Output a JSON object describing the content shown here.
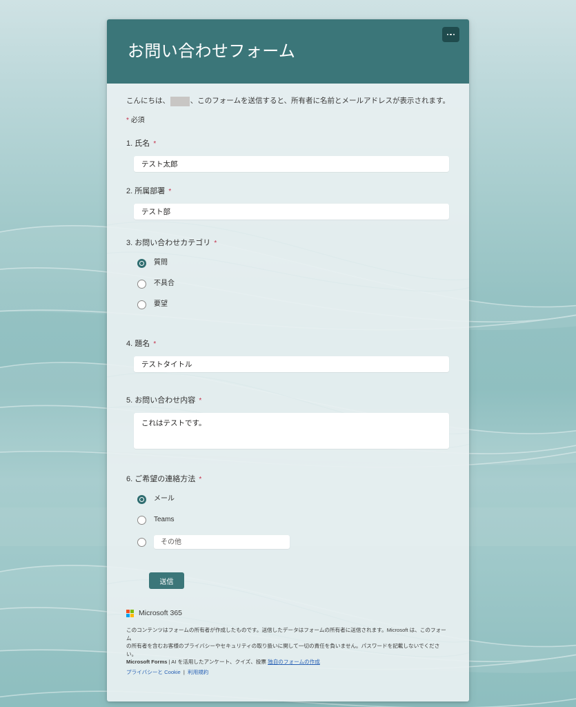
{
  "page": {
    "background_color": "#9cc4c6",
    "accent_color": "#3b7679",
    "required_color": "#c4314b"
  },
  "header": {
    "title": "お問い合わせフォーム",
    "more_button_label": "...",
    "background_color": "#3b7679"
  },
  "greeting": {
    "prefix": "こんにちは、",
    "redacted_name": "",
    "suffix": "、このフォームを送信すると、所有者に名前とメールアドレスが表示されます。"
  },
  "required_note": {
    "star": "*",
    "label": "必須"
  },
  "questions": [
    {
      "number": "1.",
      "label": "氏名",
      "required_star": "*",
      "type": "text",
      "value": "テスト太郎"
    },
    {
      "number": "2.",
      "label": "所属部署",
      "required_star": "*",
      "type": "text",
      "value": "テスト部"
    },
    {
      "number": "3.",
      "label": "お問い合わせカテゴリ",
      "required_star": "*",
      "type": "radio",
      "options": [
        {
          "label": "質問",
          "selected": true
        },
        {
          "label": "不具合",
          "selected": false
        },
        {
          "label": "要望",
          "selected": false
        }
      ]
    },
    {
      "number": "4.",
      "label": "題名",
      "required_star": "*",
      "type": "text",
      "value": "テストタイトル"
    },
    {
      "number": "5.",
      "label": "お問い合わせ内容",
      "required_star": "*",
      "type": "textarea",
      "value": "これはテストです。"
    },
    {
      "number": "6.",
      "label": "ご希望の連絡方法",
      "required_star": "*",
      "type": "radio-other",
      "options": [
        {
          "label": "メール",
          "selected": true
        },
        {
          "label": "Teams",
          "selected": false
        },
        {
          "label": "",
          "selected": false,
          "placeholder": "その他",
          "value": ""
        }
      ]
    }
  ],
  "submit": {
    "label": "送信"
  },
  "footer": {
    "brand": "Microsoft 365",
    "legal_line1": "このコンテンツはフォームの所有者が作成したものです。送信したデータはフォームの所有者に送信されます。Microsoft は、このフォーム",
    "legal_line2": "の所有者を含むお客様のプライバシーやセキュリティの取り扱いに関して一切の責任を負いません。パスワードを記載しないでください。",
    "forms_name": "Microsoft Forms",
    "forms_tagline": "| AI を活用したアンケート、クイズ、投票",
    "create_own_link": "独自のフォームの作成",
    "privacy_link": "プライバシーと Cookie",
    "separator": "|",
    "terms_link": "利用規約"
  }
}
